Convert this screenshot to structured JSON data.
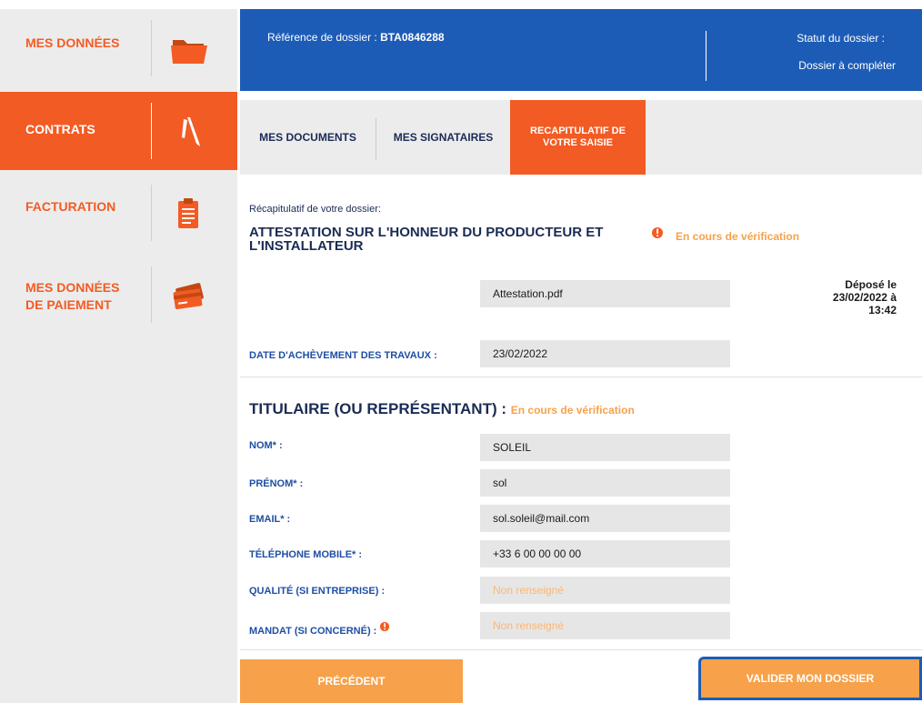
{
  "sidebar": {
    "items": [
      {
        "label": "MES DONNÉES",
        "icon": "folder-icon"
      },
      {
        "label": "CONTRATS",
        "icon": "pencils-icon"
      },
      {
        "label": "FACTURATION",
        "icon": "clipboard-icon"
      },
      {
        "label_line1": "MES DONNÉES",
        "label_line2": "DE PAIEMENT",
        "icon": "credit-cards-icon"
      }
    ]
  },
  "header": {
    "ref_label": "Référence de dossier : ",
    "ref_value": "BTA0846288",
    "status_label": "Statut du dossier :",
    "status_value": "Dossier à compléter"
  },
  "tabs": [
    {
      "label": "MES DOCUMENTS"
    },
    {
      "label": "MES SIGNATAIRES"
    },
    {
      "label_line1": "RECAPITULATIF DE",
      "label_line2": "VOTRE SAISIE"
    }
  ],
  "recap": {
    "label": "Récapitulatif de votre dossier:",
    "title": "ATTESTATION SUR L'HONNEUR DU PRODUCTEUR ET L'INSTALLATEUR",
    "status": "En cours de vérification",
    "file_name": "Attestation.pdf",
    "deposit_line1": "Déposé le",
    "deposit_line2": "23/02/2022 à",
    "deposit_line3": "13:42",
    "date_label": "DATE D'ACHÈVEMENT DES TRAVAUX :",
    "date_value": "23/02/2022"
  },
  "titulaire": {
    "title": "TITULAIRE (OU REPRÉSENTANT) : ",
    "status": "En cours de vérification",
    "fields": [
      {
        "label": "NOM* :",
        "value": "SOLEIL"
      },
      {
        "label": "PRÉNOM* :",
        "value": "sol"
      },
      {
        "label": "EMAIL* :",
        "value": "sol.soleil@mail.com"
      },
      {
        "label": "TÉLÉPHONE MOBILE* :",
        "value": "+33 6 00 00 00 00"
      },
      {
        "label": "QUALITÉ (SI ENTREPRISE) :",
        "value": "Non renseigné"
      },
      {
        "label": "MANDAT (SI CONCERNÉ) :",
        "value": "Non renseigné"
      }
    ]
  },
  "buttons": {
    "prev": "PRÉCÉDENT",
    "validate": "VALIDER MON DOSSIER"
  },
  "colors": {
    "brand_orange": "#f35b24",
    "light_orange": "#f7a14a",
    "brand_blue": "#1d5cb6",
    "label_blue": "#1f4ea5",
    "navy": "#1a2b55"
  }
}
